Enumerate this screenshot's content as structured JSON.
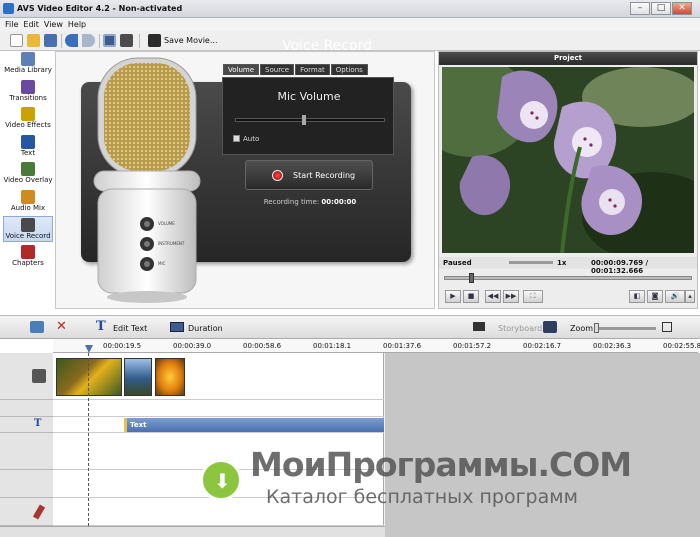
{
  "window": {
    "title": "AVS Video Editor 4.2 - Non-activated"
  },
  "menu": [
    "File",
    "Edit",
    "View",
    "Help"
  ],
  "toolbar": {
    "save_movie": "Save Movie..."
  },
  "sidebar": [
    {
      "label": "Media Library",
      "icon": "media-library-icon",
      "color": "#5c7fb8"
    },
    {
      "label": "Transitions",
      "icon": "transitions-icon",
      "color": "#6a4aa0"
    },
    {
      "label": "Video Effects",
      "icon": "video-effects-icon",
      "color": "#c9a100"
    },
    {
      "label": "Text",
      "icon": "text-icon",
      "color": "#2456a4"
    },
    {
      "label": "Video Overlay",
      "icon": "video-overlay-icon",
      "color": "#4a7a3a"
    },
    {
      "label": "Audio Mix",
      "icon": "audio-mix-icon",
      "color": "#d08a1f"
    },
    {
      "label": "Voice Record",
      "icon": "microphone-icon",
      "color": "#4a4a4a"
    },
    {
      "label": "Chapters",
      "icon": "chapters-icon",
      "color": "#b02a2a"
    }
  ],
  "voice": {
    "title": "Voice Record",
    "tabs": [
      "Volume",
      "Source",
      "Format",
      "Options"
    ],
    "mic_volume": "Mic Volume",
    "volume_level": 0.45,
    "auto_label": "Auto",
    "mic_labels": [
      "VOLUME",
      "INSTRUMENT",
      "MIC"
    ],
    "start_label": "Start Recording",
    "time_label": "Recording time:",
    "time_value": "00:00:00"
  },
  "preview": {
    "title": "Project",
    "status": "Paused",
    "speed": "1x",
    "time": "00:00:09.769 / 00:01:32.666",
    "seek_position": 0.1
  },
  "timeline": {
    "edit_text": "Edit Text",
    "duration": "Duration",
    "storyboard": "Storyboard",
    "zoom": "Zoom:",
    "ruler": [
      "00:00:19.5",
      "00:00:39.0",
      "00:00:58.6",
      "00:01:18.1",
      "00:01:37.6",
      "00:01:57.2",
      "00:02:16.7",
      "00:02:36.3",
      "00:02:55.8"
    ],
    "text_clip": "Text"
  },
  "watermark": {
    "line1": "МоиПрограммы.COM",
    "line2": "Каталог бесплатных программ"
  }
}
